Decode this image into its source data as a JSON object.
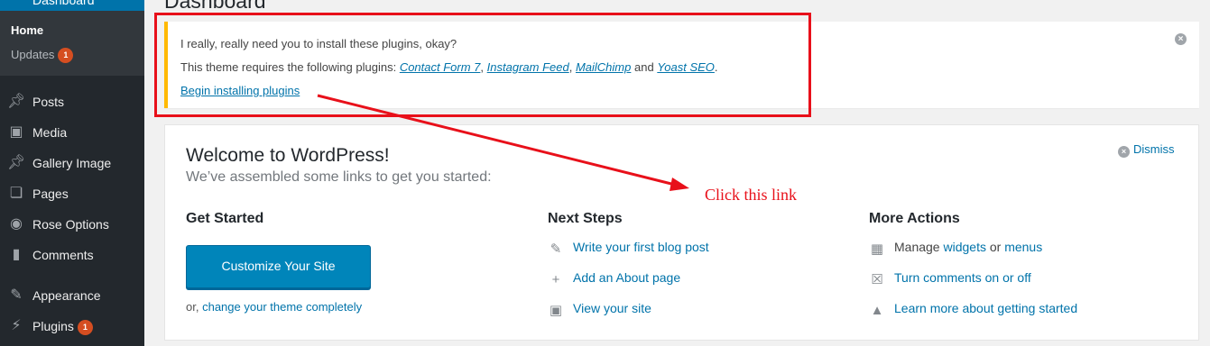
{
  "sidebar": {
    "top_item": "Dashboard",
    "submenu": [
      {
        "label": "Home"
      },
      {
        "label": "Updates",
        "badge": "1"
      }
    ],
    "items": [
      {
        "label": "Posts",
        "icon": "pushpin-icon"
      },
      {
        "label": "Media",
        "icon": "media-icon"
      },
      {
        "label": "Gallery Image",
        "icon": "pushpin-icon"
      },
      {
        "label": "Pages",
        "icon": "pages-icon"
      },
      {
        "label": "Rose Options",
        "icon": "options-icon"
      },
      {
        "label": "Comments",
        "icon": "comment-icon"
      },
      {
        "label": "Appearance",
        "icon": "brush-icon"
      },
      {
        "label": "Plugins",
        "icon": "plugin-icon",
        "badge": "1"
      }
    ]
  },
  "page": {
    "title": "Dashboard"
  },
  "notice": {
    "line1": "I really, really need you to install these plugins, okay?",
    "line2_prefix": "This theme requires the following plugins:",
    "plugins": [
      "Contact Form 7",
      "Instagram Feed",
      "MailChimp",
      "Yoast SEO"
    ],
    "sep1": ",",
    "sep2": ",",
    "and": "and",
    "period": ".",
    "begin_link": "Begin installing plugins"
  },
  "welcome": {
    "title": "Welcome to WordPress!",
    "about": "We’ve assembled some links to get you started:",
    "dismiss": "Dismiss",
    "get_started": {
      "heading": "Get Started",
      "button": "Customize Your Site",
      "or_text": "or,",
      "change_theme": "change your theme completely"
    },
    "next_steps": {
      "heading": "Next Steps",
      "items": [
        "Write your first blog post",
        "Add an About page",
        "View your site"
      ]
    },
    "more_actions": {
      "heading": "More Actions",
      "manage_prefix": "Manage",
      "widgets": "widgets",
      "or": "or",
      "menus": "menus",
      "comments_toggle": "Turn comments on or off",
      "learn_more": "Learn more about getting started"
    }
  },
  "annotation": {
    "text": "Click this link",
    "color": "#e8101a"
  },
  "colors": {
    "sidebar_bg": "#23282d",
    "accent": "#0073aa",
    "notice_border": "#ffb900",
    "badge": "#d54e21"
  }
}
